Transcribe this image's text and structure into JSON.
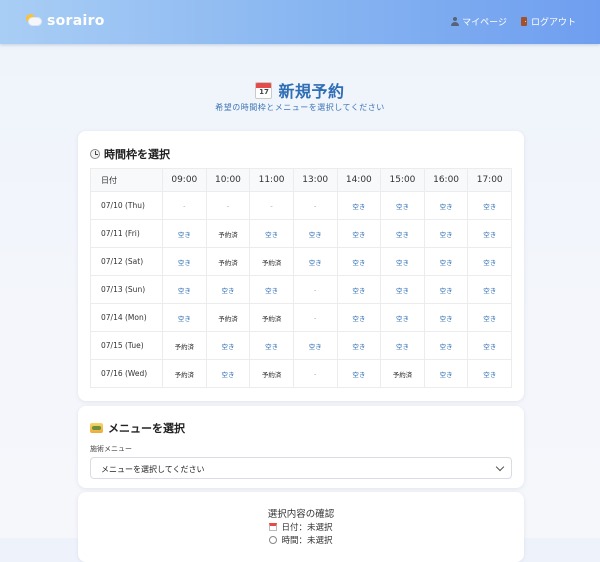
{
  "header": {
    "logo_text": "sorairo",
    "nav": [
      {
        "label": "マイページ",
        "icon": "person-icon"
      },
      {
        "label": "ログアウト",
        "icon": "door-icon"
      }
    ]
  },
  "page": {
    "title_icon_number": "17",
    "title": "新規予約",
    "subtitle": "希望の時間枠とメニューを選択してください"
  },
  "timeslot_section": {
    "heading": "時間枠を選択",
    "date_header": "日付",
    "times": [
      "09:00",
      "10:00",
      "11:00",
      "13:00",
      "14:00",
      "15:00",
      "16:00",
      "17:00"
    ],
    "rows": [
      {
        "date": "07/10 (Thu)",
        "slots": [
          "-",
          "-",
          "-",
          "-",
          "空き",
          "空き",
          "空き",
          "空き"
        ]
      },
      {
        "date": "07/11 (Fri)",
        "slots": [
          "空き",
          "予約済",
          "空き",
          "空き",
          "空き",
          "空き",
          "空き",
          "空き"
        ]
      },
      {
        "date": "07/12 (Sat)",
        "slots": [
          "空き",
          "予約済",
          "予約済",
          "空き",
          "空き",
          "空き",
          "空き",
          "空き"
        ]
      },
      {
        "date": "07/13 (Sun)",
        "slots": [
          "空き",
          "空き",
          "空き",
          "-",
          "空き",
          "空き",
          "空き",
          "空き"
        ]
      },
      {
        "date": "07/14 (Mon)",
        "slots": [
          "空き",
          "予約済",
          "予約済",
          "-",
          "空き",
          "空き",
          "空き",
          "空き"
        ]
      },
      {
        "date": "07/15 (Tue)",
        "slots": [
          "予約済",
          "空き",
          "空き",
          "空き",
          "空き",
          "空き",
          "空き",
          "空き"
        ]
      },
      {
        "date": "07/16 (Wed)",
        "slots": [
          "予約済",
          "空き",
          "予約済",
          "-",
          "空き",
          "予約済",
          "空き",
          "空き"
        ]
      }
    ]
  },
  "menu_section": {
    "heading": "メニューを選択",
    "field_label": "施術メニュー",
    "select_value": "メニューを選択してください"
  },
  "confirm_section": {
    "heading": "選択内容の確認",
    "date_line": "日付：未選択",
    "time_line": "時間：未選択"
  },
  "colors": {
    "accent": "#2f6db4",
    "header_start": "#a9cef5",
    "header_end": "#6f9ef0"
  }
}
